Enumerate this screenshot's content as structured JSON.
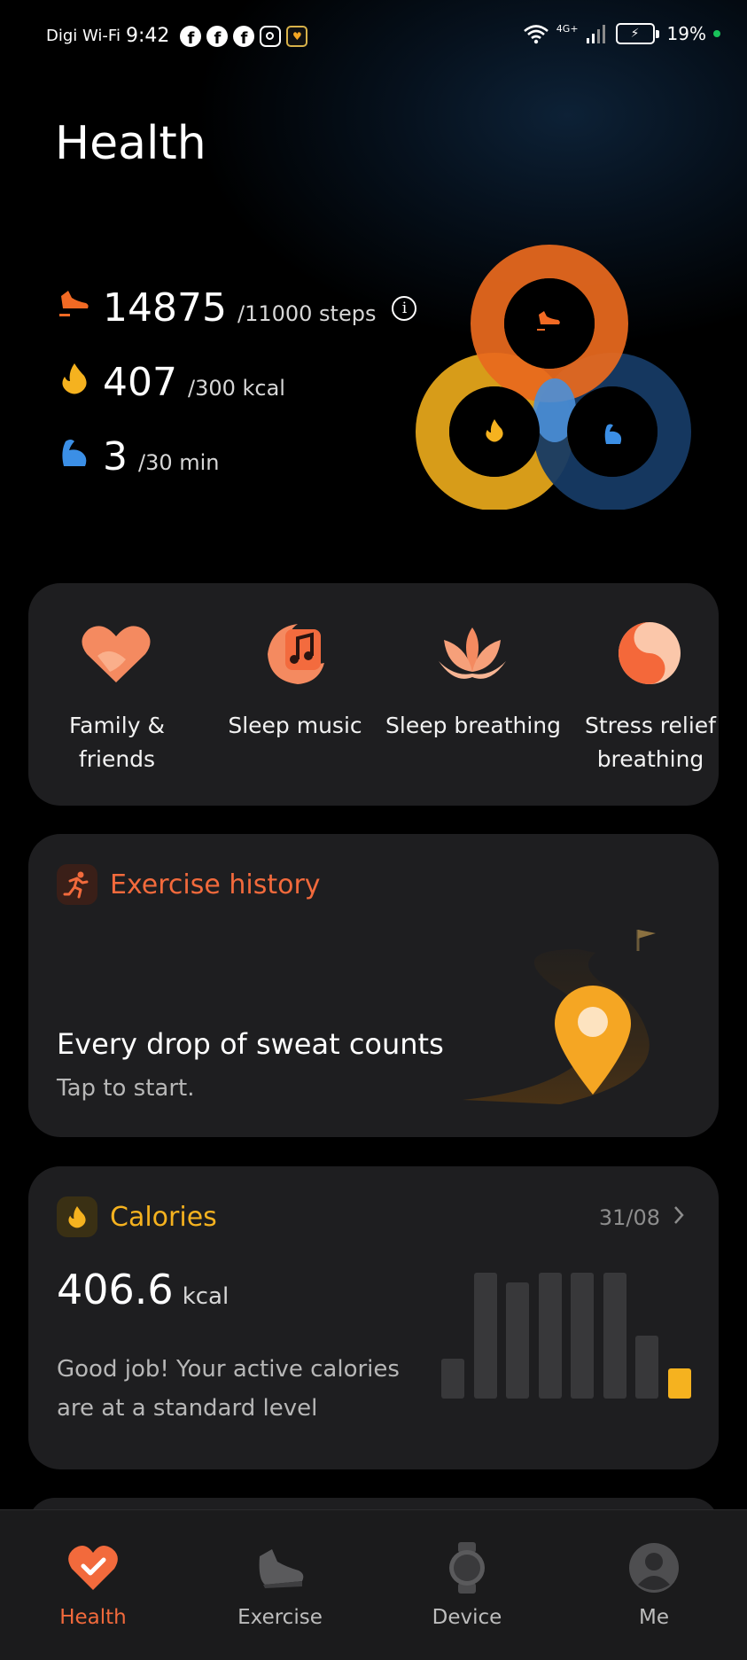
{
  "status_bar": {
    "carrier": "Digi Wi-Fi",
    "time": "9:42",
    "notification_icons": [
      "facebook-icon",
      "facebook-icon",
      "facebook-icon",
      "instagram-icon",
      "app-icon"
    ],
    "network": "4G+",
    "battery": "19%",
    "dot_color": "#19c25a"
  },
  "header": {
    "title": "Health"
  },
  "activity": {
    "steps": {
      "value": "14875",
      "goal": "/11000 steps",
      "icon": "shoe-icon",
      "color": "#f26a24"
    },
    "calories": {
      "value": "407",
      "goal": "/300 kcal",
      "icon": "flame-icon",
      "color": "#f5b21f"
    },
    "minutes": {
      "value": "3",
      "goal": "/30 min",
      "icon": "muscle-icon",
      "color": "#3b8fe6"
    }
  },
  "shortcuts": [
    {
      "label": "Family & friends",
      "icon": "heart-hands-icon"
    },
    {
      "label": "Sleep music",
      "icon": "moon-music-icon"
    },
    {
      "label": "Sleep breathing",
      "icon": "lotus-icon"
    },
    {
      "label": "Stress relief breathing",
      "icon": "yin-yang-icon"
    }
  ],
  "exercise_card": {
    "title": "Exercise history",
    "headline": "Every drop of sweat counts",
    "subtext": "Tap to start.",
    "accent": "#f26a3c"
  },
  "calories_card": {
    "title": "Calories",
    "date": "31/08",
    "value": "406.6",
    "unit": "kcal",
    "message_line1": "Good job! Your active calories",
    "message_line2": "are at a standard level",
    "accent": "#f5b21f",
    "bar_levels": [
      0.32,
      1.0,
      0.92,
      1.0,
      1.0,
      1.0,
      0.5,
      0.24
    ]
  },
  "bottom_nav": [
    {
      "label": "Health",
      "icon": "heart-check-icon",
      "active": true
    },
    {
      "label": "Exercise",
      "icon": "sneaker-icon",
      "active": false
    },
    {
      "label": "Device",
      "icon": "watch-icon",
      "active": false
    },
    {
      "label": "Me",
      "icon": "user-avatar-icon",
      "active": false
    }
  ]
}
